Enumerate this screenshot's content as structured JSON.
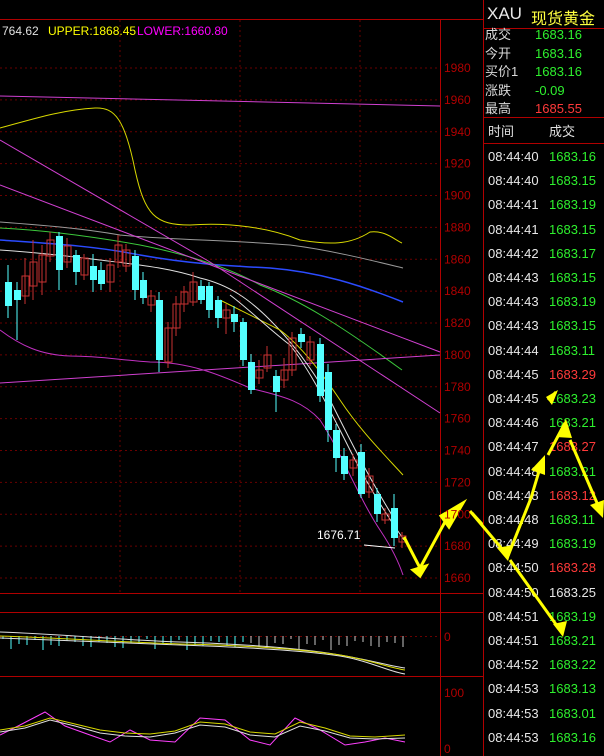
{
  "header": {
    "mid_value": "764.62",
    "upper_label": "UPPER:1868.45",
    "lower_label": "LOWER:1660.80"
  },
  "price_axis": {
    "labels": [
      "1980",
      "1960",
      "1940",
      "1920",
      "1900",
      "1880",
      "1860",
      "1840",
      "1820",
      "1800",
      "1780",
      "1760",
      "1740",
      "1720",
      "1700",
      "1680",
      "1660"
    ]
  },
  "macd_axis": {
    "zero_label": "0"
  },
  "kdj_axis": {
    "top_label": "100",
    "bottom_label": "0"
  },
  "annotations": {
    "low_price": "1676.71"
  },
  "quote": {
    "symbol": "XAU",
    "name": "现货黄金",
    "rows": [
      {
        "label": "成交",
        "value": "1683.16",
        "color": "#2ef02e"
      },
      {
        "label": "今开",
        "value": "1683.16",
        "color": "#2ef02e"
      },
      {
        "label": "买价1",
        "value": "1683.16",
        "color": "#2ef02e"
      },
      {
        "label": "涨跌",
        "value": "-0.09",
        "color": "#2ef02e"
      },
      {
        "label": "最高",
        "value": "1685.55",
        "color": "#ff3a3a"
      }
    ]
  },
  "ticks": {
    "header_time": "时间",
    "header_price": "成交",
    "rows": [
      {
        "time": "08:44:40",
        "price": "1683.16",
        "color": "green"
      },
      {
        "time": "08:44:40",
        "price": "1683.15",
        "color": "green"
      },
      {
        "time": "08:44:41",
        "price": "1683.19",
        "color": "green"
      },
      {
        "time": "08:44:41",
        "price": "1683.15",
        "color": "green"
      },
      {
        "time": "08:44:42",
        "price": "1683.17",
        "color": "green"
      },
      {
        "time": "08:44:43",
        "price": "1683.15",
        "color": "green"
      },
      {
        "time": "08:44:43",
        "price": "1683.19",
        "color": "green"
      },
      {
        "time": "08:44:43",
        "price": "1683.15",
        "color": "green"
      },
      {
        "time": "08:44:44",
        "price": "1683.11",
        "color": "green"
      },
      {
        "time": "08:44:45",
        "price": "1683.29",
        "color": "red"
      },
      {
        "time": "08:44:45",
        "price": "1683.23",
        "color": "green"
      },
      {
        "time": "08:44:46",
        "price": "1683.21",
        "color": "green"
      },
      {
        "time": "08:44:47",
        "price": "1683.27",
        "color": "red"
      },
      {
        "time": "08:44:48",
        "price": "1683.21",
        "color": "green"
      },
      {
        "time": "08:44:48",
        "price": "1683.12",
        "color": "red"
      },
      {
        "time": "08:44:48",
        "price": "1683.11",
        "color": "green"
      },
      {
        "time": "08:44:49",
        "price": "1683.19",
        "color": "green"
      },
      {
        "time": "08:44:50",
        "price": "1683.28",
        "color": "red"
      },
      {
        "time": "08:44:50",
        "price": "1683.25",
        "color": "white"
      },
      {
        "time": "08:44:51",
        "price": "1683.19",
        "color": "green"
      },
      {
        "time": "08:44:51",
        "price": "1683.21",
        "color": "green"
      },
      {
        "time": "08:44:52",
        "price": "1683.22",
        "color": "green"
      },
      {
        "time": "08:44:53",
        "price": "1683.13",
        "color": "green"
      },
      {
        "time": "08:44:53",
        "price": "1683.01",
        "color": "green"
      },
      {
        "time": "08:44:53",
        "price": "1683.16",
        "color": "green"
      }
    ]
  },
  "colors": {
    "axis_red": "#b00000",
    "grid_red": "#6a0000",
    "up_candle": "#c83232",
    "down_candle": "#54ffff",
    "upper_label": "#ffff00",
    "lower_label": "#ff00ff",
    "arrow": "#ffff00"
  }
}
